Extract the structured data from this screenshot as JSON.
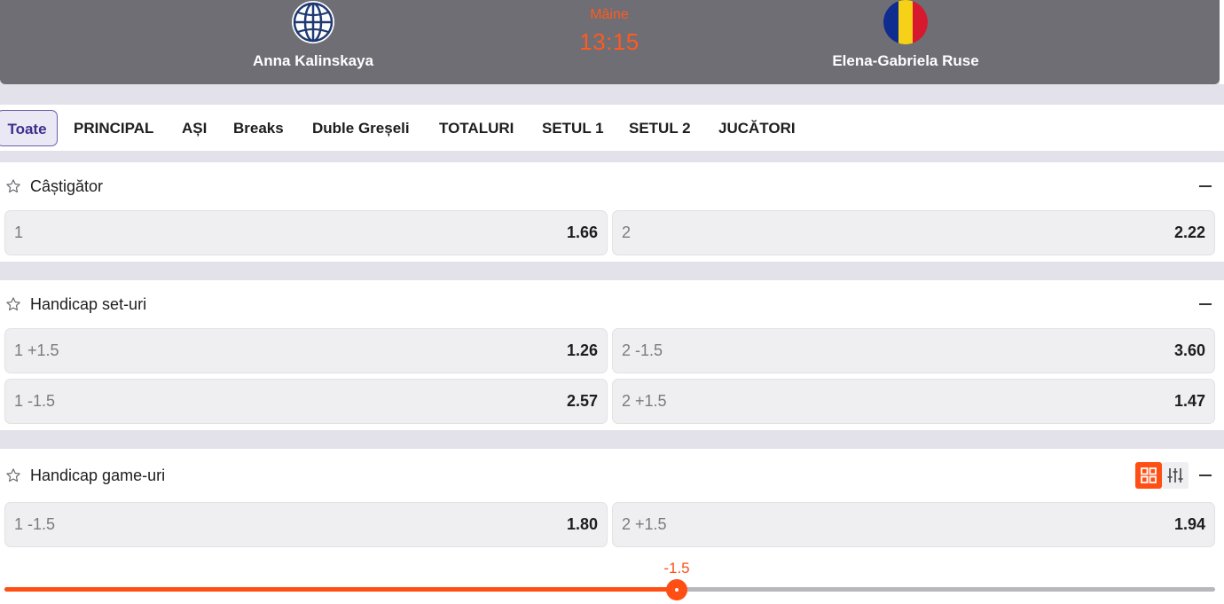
{
  "header": {
    "player1": {
      "name": "Anna Kalinskaya",
      "flag_icon": "globe-icon"
    },
    "player2": {
      "name": "Elena-Gabriela Ruse",
      "flag_icon": "romania-flag-icon"
    },
    "day": "Mâine",
    "time": "13:15"
  },
  "tabs": [
    "Toate",
    "PRINCIPAL",
    "AȘI",
    "Breaks",
    "Duble Greșeli",
    "TOTALURI",
    "SETUL 1",
    "SETUL 2",
    "JUCĂTORI"
  ],
  "active_tab": "Toate",
  "markets": [
    {
      "title": "Câștigător",
      "rows": [
        [
          {
            "label": "1",
            "odd": "1.66"
          },
          {
            "label": "2",
            "odd": "2.22"
          }
        ]
      ]
    },
    {
      "title": "Handicap set-uri",
      "rows": [
        [
          {
            "label": "1 +1.5",
            "odd": "1.26"
          },
          {
            "label": "2 -1.5",
            "odd": "3.60"
          }
        ],
        [
          {
            "label": "1 -1.5",
            "odd": "2.57"
          },
          {
            "label": "2 +1.5",
            "odd": "1.47"
          }
        ]
      ]
    },
    {
      "title": "Handicap game-uri",
      "rows": [
        [
          {
            "label": "1 -1.5",
            "odd": "1.80"
          },
          {
            "label": "2 +1.5",
            "odd": "1.94"
          }
        ]
      ]
    }
  ],
  "handicap_slider": {
    "value": "-1.5",
    "position_fraction": 0.55
  },
  "colors": {
    "accent": "#ff4f14",
    "header_bg": "#6f6e74",
    "active_tab": "#3d2e8c"
  }
}
